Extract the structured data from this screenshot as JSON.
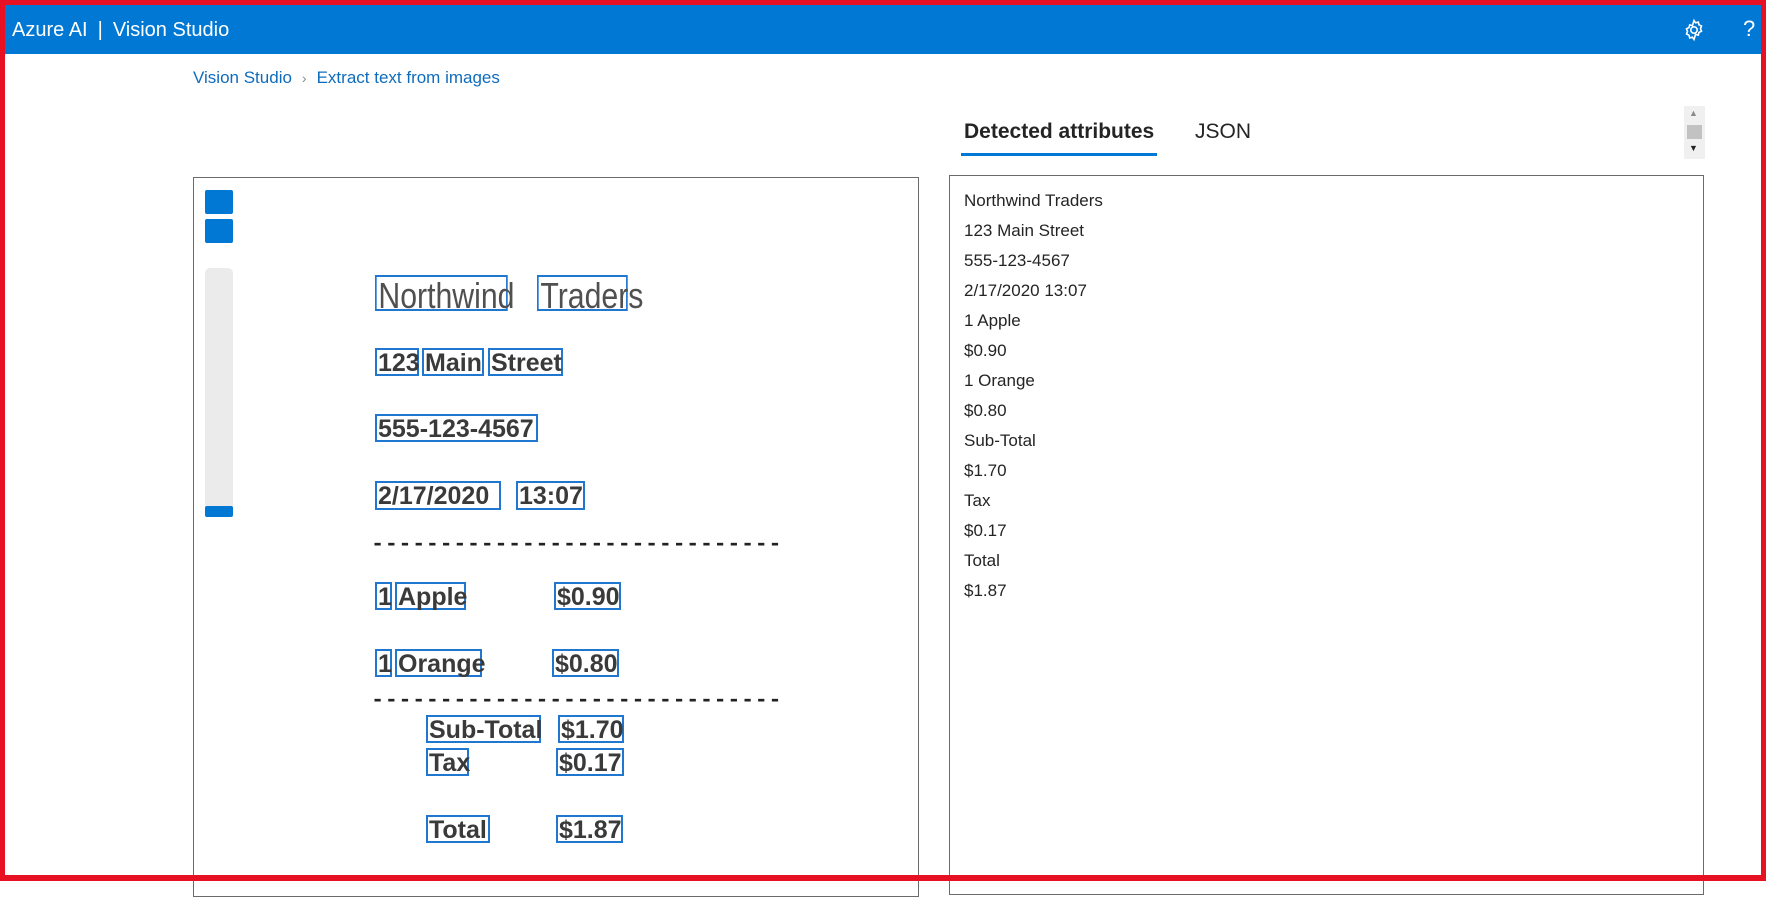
{
  "header": {
    "brand": "Azure AI",
    "separator": "|",
    "product": "Vision Studio",
    "help": "?"
  },
  "breadcrumb": {
    "root": "Vision Studio",
    "current": "Extract text from images"
  },
  "tabs": {
    "detected": "Detected attributes",
    "json": "JSON"
  },
  "receipt": {
    "company": [
      "Northwind",
      "Traders"
    ],
    "address": [
      "123",
      "Main",
      "Street"
    ],
    "phone": "555-123-4567",
    "date": "2/17/2020",
    "time": "13:07",
    "dashes": "------------------------------",
    "item1_qty": "1",
    "item1_name": "Apple",
    "item1_price": "$0.90",
    "item2_qty": "1",
    "item2_name": "Orange",
    "item2_price": "$0.80",
    "subtotal_label": "Sub-Total",
    "subtotal_value": "$1.70",
    "tax_label": "Tax",
    "tax_value": "$0.17",
    "total_label": "Total",
    "total_value": "$1.87"
  },
  "results": [
    "Northwind Traders",
    "123 Main Street",
    "555-123-4567",
    "2/17/2020 13:07",
    "1 Apple",
    "$0.90",
    "1 Orange",
    "$0.80",
    "Sub-Total",
    "$1.70",
    "Tax",
    "$0.17",
    "Total",
    "$1.87"
  ],
  "colors": {
    "accent": "#0078d4",
    "frame": "#e81123",
    "link": "#0f6cbd",
    "box": "#1f77d0"
  }
}
